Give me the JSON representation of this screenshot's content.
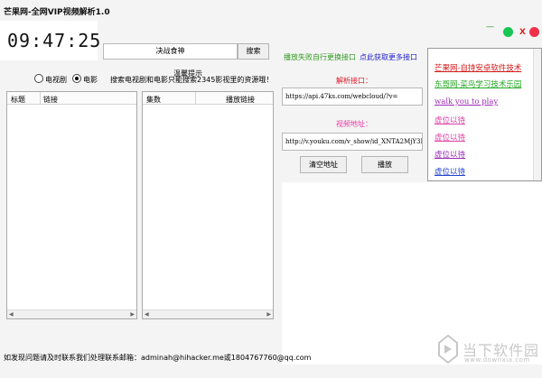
{
  "window": {
    "title": "芒果网-全网VIP视频解析1.0",
    "minimize_symbol": "—",
    "close_symbol": "X"
  },
  "clock": {
    "time": "09:47:25"
  },
  "search": {
    "value": "决战食神",
    "button": "搜索"
  },
  "category": {
    "options": [
      "电视剧",
      "电影"
    ],
    "selected": "电影"
  },
  "tip": {
    "title": "温馨提示",
    "text": "搜索电视剧和电影只能搜索2345影视里的资源哦！"
  },
  "left_list": {
    "columns": [
      "标题",
      "链接"
    ]
  },
  "episode_list": {
    "columns": [
      "集数",
      "播放链接"
    ]
  },
  "hints": {
    "fail": "播放失败自行更换接口",
    "more": "点此获取更多接口"
  },
  "api": {
    "label": "解析接口：",
    "value": "https://api.47ks.com/webcloud/?v="
  },
  "video": {
    "label": "视频地址：",
    "value": "http://v.youku.com/v_show/id_XNTA2MjY3N"
  },
  "buttons": {
    "clear": "清空地址",
    "play": "播放"
  },
  "links": [
    {
      "text": "芒果网-自持安卓软件技术",
      "color": "#d41a1a"
    },
    {
      "text": "东哥网-菜鸟学习技术乐园",
      "color": "#27a827"
    },
    {
      "text": "walk you to play",
      "color": "#9b2ab5"
    },
    {
      "text": "虚位以待",
      "color": "#e040a8"
    },
    {
      "text": "虚位以待",
      "color": "#e040a8"
    },
    {
      "text": "虚位以待",
      "color": "#9b2ab5"
    },
    {
      "text": "虚位以待",
      "color": "#2244cc"
    }
  ],
  "footer": {
    "text": "如发现问题请及时联系我们处理联系邮箱：adminah@hihacker.me或1804767760@qq.com"
  },
  "watermark": {
    "name": "当下软件园",
    "url": "www.downxia.com"
  },
  "colors": {
    "green_dot": "#17c653",
    "red_dot": "#f0304a",
    "red_label": "#e0182a",
    "pink_label": "#ea3ba6"
  }
}
